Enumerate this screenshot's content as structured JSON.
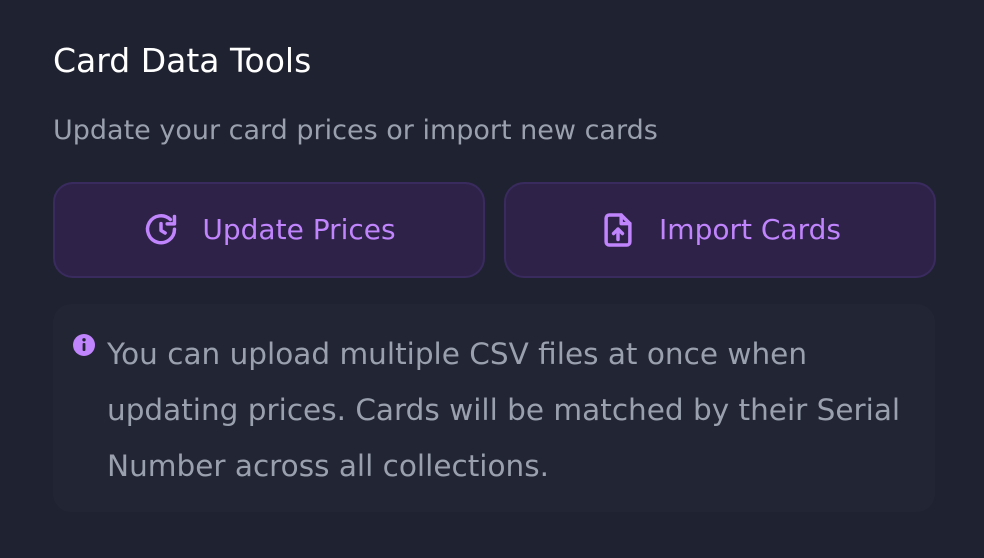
{
  "panel": {
    "title": "Card Data Tools",
    "subtitle": "Update your card prices or import new cards"
  },
  "buttons": {
    "update_prices": {
      "label": "Update Prices",
      "icon": "refresh-clock-icon"
    },
    "import_cards": {
      "label": "Import Cards",
      "icon": "file-upload-icon"
    }
  },
  "info_note": {
    "icon": "info-icon",
    "text": "You can upload multiple CSV files at once when updating prices. Cards will be matched by their Serial Number across all collections."
  },
  "colors": {
    "background": "#1f2230",
    "accent": "#c084fc",
    "button_background": "#2e2249",
    "button_border": "#3a2b5e",
    "title": "#ffffff",
    "muted_text": "#9aa0ae",
    "note_background": "#222534"
  }
}
